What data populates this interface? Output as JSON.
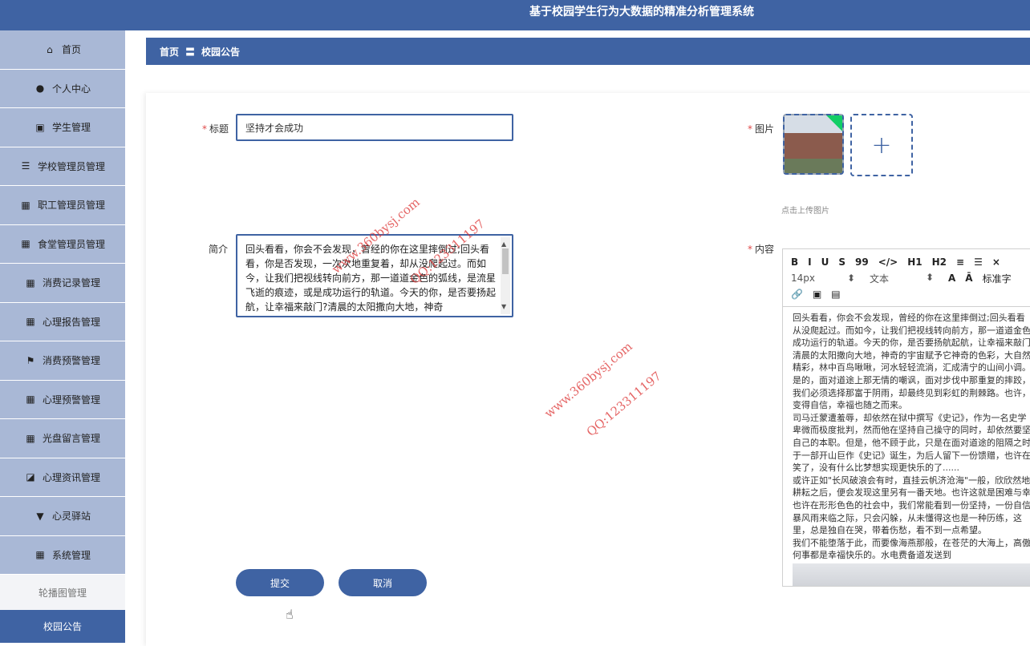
{
  "app": {
    "title": "基于校园学生行为大数据的精准分析管理系统"
  },
  "sidebar": {
    "items": [
      {
        "label": "首页",
        "icon": "home-icon",
        "glyph": "⌂"
      },
      {
        "label": "个人中心",
        "icon": "user-icon",
        "glyph": "●"
      },
      {
        "label": "学生管理",
        "icon": "clipboard-icon",
        "glyph": "▣"
      },
      {
        "label": "学校管理员管理",
        "icon": "list-icon",
        "glyph": "☰"
      },
      {
        "label": "职工管理员管理",
        "icon": "grid-icon",
        "glyph": "▦"
      },
      {
        "label": "食堂管理员管理",
        "icon": "grid-icon",
        "glyph": "▦"
      },
      {
        "label": "消费记录管理",
        "icon": "grid-icon",
        "glyph": "▦"
      },
      {
        "label": "心理报告管理",
        "icon": "grid-icon",
        "glyph": "▦"
      },
      {
        "label": "消费预警管理",
        "icon": "flag-icon",
        "glyph": "⚑"
      },
      {
        "label": "心理预警管理",
        "icon": "grid-icon",
        "glyph": "▦"
      },
      {
        "label": "光盘留言管理",
        "icon": "grid-icon",
        "glyph": "▦"
      },
      {
        "label": "心理资讯管理",
        "icon": "chart-icon",
        "glyph": "◪"
      },
      {
        "label": "心灵驿站",
        "icon": "brush-icon",
        "glyph": "▼"
      },
      {
        "label": "系统管理",
        "icon": "grid-icon",
        "glyph": "▦"
      }
    ],
    "sub_items": [
      "轮播图管理",
      "校园公告"
    ]
  },
  "breadcrumb": {
    "home": "首页",
    "separator": "〓",
    "current": "校园公告"
  },
  "form": {
    "title_label": "标题",
    "title_value": "坚持才会成功",
    "intro_label": "简介",
    "intro_value": "回头看看，你会不会发现，曾经的你在这里摔倒过;回头看看，你是否发现，一次次地重复着，却从没爬起过。而如今，让我们把视线转向前方，那一道道金色的弧线，是流星飞逝的痕迹，或是成功运行的轨道。今天的你，是否要扬起航，让幸福来敲门?清晨的太阳撒向大地，神奇",
    "image_label": "图片",
    "upload_plus": "+",
    "upload_hint": "点击上传图片",
    "content_label": "内容",
    "required_mark": "*"
  },
  "editor": {
    "toolbar_row1": [
      "B",
      "I",
      "U",
      "S",
      "99",
      "</>",
      "H1",
      "H2",
      "≡",
      "☰",
      "×"
    ],
    "font_size": "14px",
    "block_type": "文本",
    "font_family": "标准字",
    "toolbar_row2_extra": [
      "A",
      "Ā"
    ],
    "toolbar_row3": [
      "🔗",
      "▣",
      "▤"
    ],
    "content_lines": [
      "回头看看，你会不会发现，曾经的你在这里摔倒过;回头看看",
      "从没爬起过。而如今，让我们把视线转向前方，那一道道金色",
      "成功运行的轨道。今天的你，是否要扬航起航，让幸福来敲门",
      "清晨的太阳撒向大地，神奇的宇宙赋予它神奇的色彩，大自然",
      "精彩，林中百鸟啾啾，河水轻轻流淌，汇成清宁的山间小调。",
      "是的，面对道途上那无情的嘲讽，面对步伐中那重复的摔跤，",
      "我们必须选择那富于阴雨，却最终见到彩虹的荆棘路。也许，",
      "变得自信，幸福也随之而来。",
      "司马迁蒙遭羞辱，却依然在狱中撰写《史记》，作为一名史学",
      "卑微而极度批判，然而他在坚持自己操守的同时，却依然要坚",
      "自己的本职。但是，他不顾于此，只是在面对道途的阻隔之时",
      "于一部开山巨作《史记》诞生，为后人留下一份馈赠，也许在",
      "笑了，没有什么比梦想实现更快乐的了......",
      "或许正如\"长风破浪会有时，直挂云帆济沧海\"一般，欣欣然地",
      "耕耘之后，便会发现这里另有一番天地。也许这就是困难与幸",
      "也许在形形色色的社会中，我们常能看到一份坚持，一份自信",
      "暴风雨来临之际，只会闪躲，从未懂得这也是一种历练，这",
      "里，总是独自在哭，带着伤愁，看不到一点希望。",
      "我们不能堕落于此，而要像海燕那般，在苍茫的大海上，高傲",
      "何事都是幸福快乐的。水电费备道发送到"
    ]
  },
  "buttons": {
    "submit": "提交",
    "cancel": "取消"
  },
  "watermark": {
    "site": "www.360bysj.com",
    "qq": "QQ:123311197"
  },
  "colors": {
    "primary": "#3f63a3",
    "sidebar": "#a9b8d6",
    "required": "#e04a4a"
  }
}
